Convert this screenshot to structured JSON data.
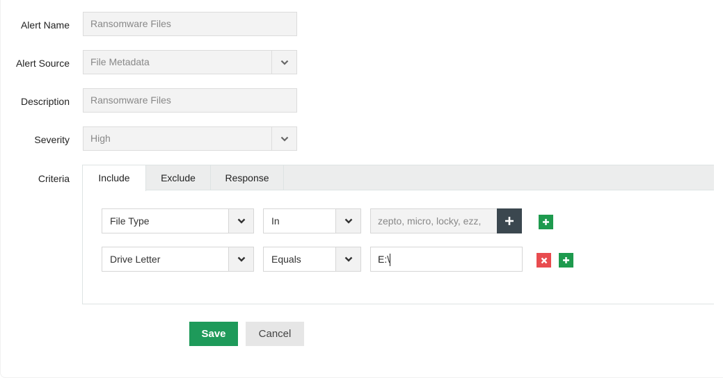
{
  "form": {
    "alert_name": {
      "label": "Alert Name",
      "value": "Ransomware Files"
    },
    "alert_source": {
      "label": "Alert Source",
      "value": "File Metadata"
    },
    "description": {
      "label": "Description",
      "value": "Ransomware Files"
    },
    "severity": {
      "label": "Severity",
      "value": "High"
    },
    "criteria": {
      "label": "Criteria",
      "tabs": [
        {
          "label": "Include",
          "active": true
        },
        {
          "label": "Exclude",
          "active": false
        },
        {
          "label": "Response",
          "active": false
        }
      ],
      "rows": [
        {
          "field": "File Type",
          "operator": "In",
          "value": "zepto, micro, locky, ezz,"
        },
        {
          "field": "Drive Letter",
          "operator": "Equals",
          "value": "E:\\"
        }
      ]
    }
  },
  "actions": {
    "save_label": "Save",
    "cancel_label": "Cancel"
  },
  "colors": {
    "save": "#1e9a5a",
    "add": "#1e9a4e",
    "remove": "#e84c4f",
    "add_value": "#3b474f"
  }
}
